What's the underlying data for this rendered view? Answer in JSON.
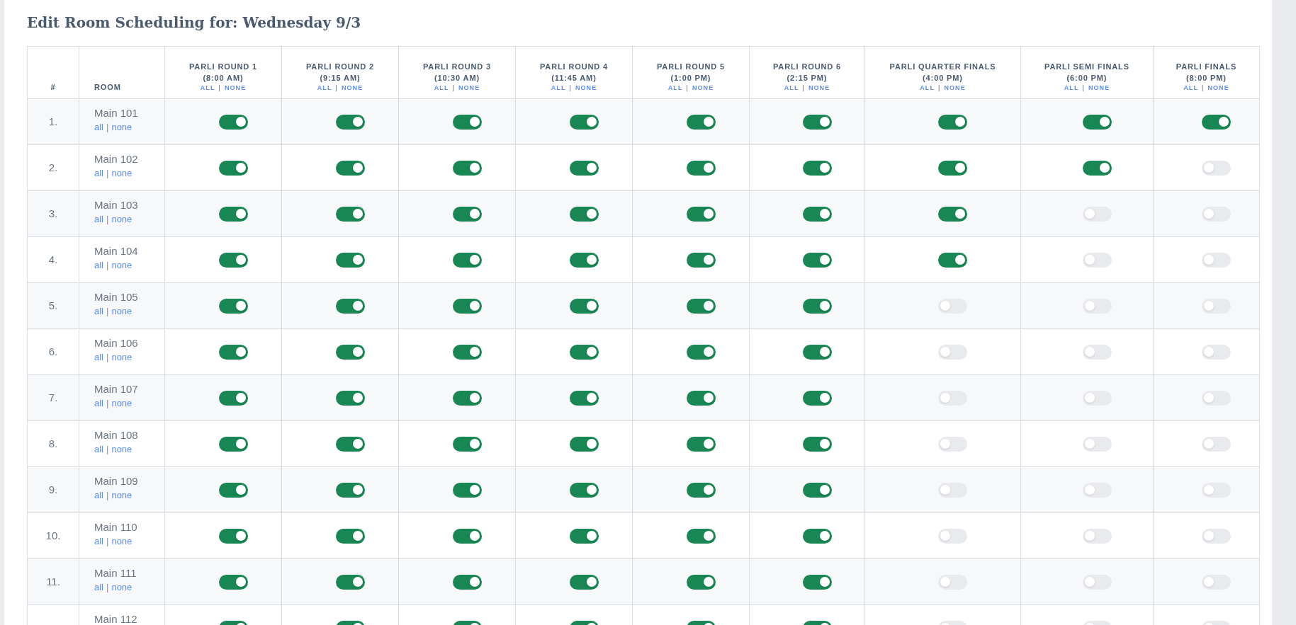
{
  "title": "Edit Room Scheduling for: Wednesday 9/3",
  "table": {
    "columns": [
      {
        "label": "#"
      },
      {
        "label": "ROOM"
      },
      {
        "label": "PARLI ROUND 1",
        "time": "(8:00 AM)",
        "all_link": "ALL",
        "separator": "|",
        "none_link": "NONE"
      },
      {
        "label": "PARLI ROUND 2",
        "time": "(9:15 AM)",
        "all_link": "ALL",
        "separator": "|",
        "none_link": "NONE"
      },
      {
        "label": "PARLI ROUND 3",
        "time": "(10:30 AM)",
        "all_link": "ALL",
        "separator": "|",
        "none_link": "NONE"
      },
      {
        "label": "PARLI ROUND 4",
        "time": "(11:45 AM)",
        "all_link": "ALL",
        "separator": "|",
        "none_link": "NONE"
      },
      {
        "label": "PARLI ROUND 5",
        "time": "(1:00 PM)",
        "all_link": "ALL",
        "separator": "|",
        "none_link": "NONE"
      },
      {
        "label": "PARLI ROUND 6",
        "time": "(2:15 PM)",
        "all_link": "ALL",
        "separator": "|",
        "none_link": "NONE"
      },
      {
        "label": "PARLI QUARTER FINALS",
        "time": "(4:00 PM)",
        "all_link": "ALL",
        "separator": "|",
        "none_link": "NONE"
      },
      {
        "label": "PARLI SEMI FINALS",
        "time": "(6:00 PM)",
        "all_link": "ALL",
        "separator": "|",
        "none_link": "NONE"
      },
      {
        "label": "PARLI FINALS",
        "time": "(8:00 PM)",
        "all_link": "ALL",
        "separator": "|",
        "none_link": "NONE"
      }
    ],
    "rows": [
      {
        "number": "1.",
        "room": "Main 101",
        "all_link": "all",
        "separator": "|",
        "none_link": "none",
        "toggles": [
          true,
          true,
          true,
          true,
          true,
          true,
          true,
          true,
          true
        ]
      },
      {
        "number": "2.",
        "room": "Main 102",
        "all_link": "all",
        "separator": "|",
        "none_link": "none",
        "toggles": [
          true,
          true,
          true,
          true,
          true,
          true,
          true,
          true,
          false
        ]
      },
      {
        "number": "3.",
        "room": "Main 103",
        "all_link": "all",
        "separator": "|",
        "none_link": "none",
        "toggles": [
          true,
          true,
          true,
          true,
          true,
          true,
          true,
          false,
          false
        ]
      },
      {
        "number": "4.",
        "room": "Main 104",
        "all_link": "all",
        "separator": "|",
        "none_link": "none",
        "toggles": [
          true,
          true,
          true,
          true,
          true,
          true,
          true,
          false,
          false
        ]
      },
      {
        "number": "5.",
        "room": "Main 105",
        "all_link": "all",
        "separator": "|",
        "none_link": "none",
        "toggles": [
          true,
          true,
          true,
          true,
          true,
          true,
          false,
          false,
          false
        ]
      },
      {
        "number": "6.",
        "room": "Main 106",
        "all_link": "all",
        "separator": "|",
        "none_link": "none",
        "toggles": [
          true,
          true,
          true,
          true,
          true,
          true,
          false,
          false,
          false
        ]
      },
      {
        "number": "7.",
        "room": "Main 107",
        "all_link": "all",
        "separator": "|",
        "none_link": "none",
        "toggles": [
          true,
          true,
          true,
          true,
          true,
          true,
          false,
          false,
          false
        ]
      },
      {
        "number": "8.",
        "room": "Main 108",
        "all_link": "all",
        "separator": "|",
        "none_link": "none",
        "toggles": [
          true,
          true,
          true,
          true,
          true,
          true,
          false,
          false,
          false
        ]
      },
      {
        "number": "9.",
        "room": "Main 109",
        "all_link": "all",
        "separator": "|",
        "none_link": "none",
        "toggles": [
          true,
          true,
          true,
          true,
          true,
          true,
          false,
          false,
          false
        ]
      },
      {
        "number": "10.",
        "room": "Main 110",
        "all_link": "all",
        "separator": "|",
        "none_link": "none",
        "toggles": [
          true,
          true,
          true,
          true,
          true,
          true,
          false,
          false,
          false
        ]
      },
      {
        "number": "11.",
        "room": "Main 111",
        "all_link": "all",
        "separator": "|",
        "none_link": "none",
        "toggles": [
          true,
          true,
          true,
          true,
          true,
          true,
          false,
          false,
          false
        ]
      },
      {
        "room": "Main 112",
        "toggles": [
          true,
          true,
          true,
          true,
          true,
          true,
          false,
          false,
          false
        ]
      }
    ]
  }
}
